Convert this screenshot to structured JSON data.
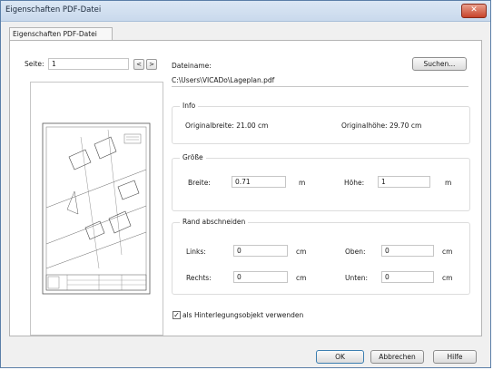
{
  "window": {
    "title": "Eigenschaften PDF-Datei",
    "close_glyph": "✕"
  },
  "tabs": [
    {
      "label": "Eigenschaften PDF-Datei"
    }
  ],
  "page_selector": {
    "label": "Seite:",
    "value": "1",
    "prev": "<",
    "next": ">"
  },
  "file": {
    "label": "Dateiname:",
    "path": "C:\\Users\\VICADo\\Lageplan.pdf",
    "browse_label": "Suchen..."
  },
  "info": {
    "title": "Info",
    "width_text": "Originalbreite: 21.00 cm",
    "height_text": "Originalhöhe: 29.70 cm"
  },
  "size": {
    "title": "Größe",
    "width_label": "Breite:",
    "width_value": "0.71",
    "width_unit": "m",
    "height_label": "Höhe:",
    "height_value": "1",
    "height_unit": "m"
  },
  "crop": {
    "title": "Rand abschneiden",
    "left_label": "Links:",
    "left_value": "0",
    "left_unit": "cm",
    "top_label": "Oben:",
    "top_value": "0",
    "top_unit": "cm",
    "right_label": "Rechts:",
    "right_value": "0",
    "right_unit": "cm",
    "bottom_label": "Unten:",
    "bottom_value": "0",
    "bottom_unit": "cm"
  },
  "background_option": {
    "label": "als Hinterlegungsobjekt verwenden",
    "checked": true,
    "check_glyph": "✓"
  },
  "buttons": {
    "ok": "OK",
    "cancel": "Abbrechen",
    "help": "Hilfe"
  }
}
